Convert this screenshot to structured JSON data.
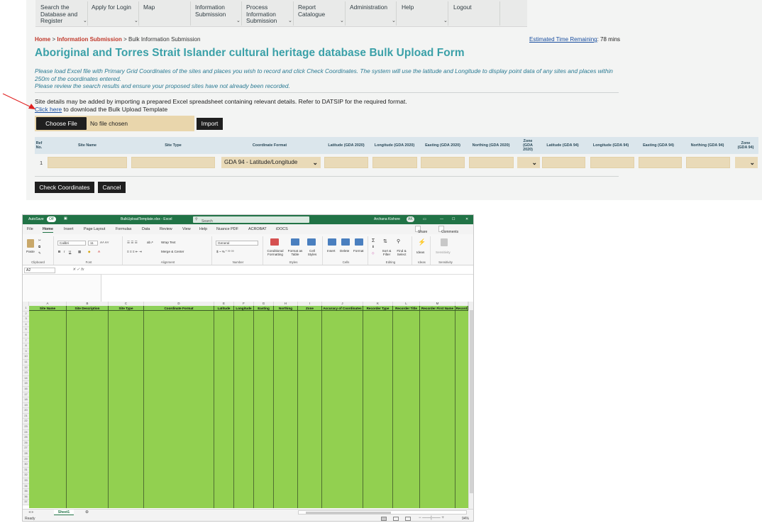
{
  "nav": {
    "items": [
      {
        "label": "Search the\nDatabase and\nRegister",
        "caret": true
      },
      {
        "label": "Apply for Login",
        "caret": true
      },
      {
        "label": "Map",
        "caret": false
      },
      {
        "label": "Information\nSubmission",
        "caret": true
      },
      {
        "label": "Process\nInformation\nSubmission",
        "caret": true
      },
      {
        "label": "Report\nCatalogue",
        "caret": true
      },
      {
        "label": "Administration",
        "caret": true
      },
      {
        "label": "Help",
        "caret": true
      },
      {
        "label": "Logout",
        "caret": false
      }
    ]
  },
  "breadcrumb": {
    "home": "Home",
    "sep1": " > ",
    "section": "Information Submission",
    "sep2": " > ",
    "current": "Bulk Information Submission"
  },
  "timer": {
    "label": "Estimated Time Remaining",
    "value": ": 78 mins"
  },
  "page": {
    "title": "Aboriginal and Torres Strait Islander cultural heritage database Bulk Upload Form",
    "intro1": "Please load Excel file with Primary Grid Coordinates of the sites and places you wish to record and click Check Coordinates. The system will use the latitude and Longitude to display point data of any sites and places within 250m of the coordinates entered.",
    "intro2": "Please review the search results and ensure your proposed sites have not already been recorded.",
    "note": "Site details may be added by importing a prepared Excel spreadsheet containing relevant details. Refer to DATSIP for the required format.",
    "click_here": "Click here",
    "download_text": " to download the Bulk Upload Template"
  },
  "upload": {
    "choose_label": "Choose File",
    "no_file": "No file chosen",
    "import_label": "Import"
  },
  "table": {
    "headers": [
      "Ref\nNo.",
      "Site Name",
      "Site Type",
      "Coordinate Format",
      "Latitude (GDA 2020)",
      "Longitude (GDA 2020)",
      "Easting (GDA 2020)",
      "Northing (GDA 2020)",
      "Zone\n(GDA\n2020)",
      "Latitude (GDA 94)",
      "Longitude (GDA 94)",
      "Easting (GDA 94)",
      "Northing (GDA 94)",
      "Zone\n(GDA 94)"
    ],
    "row_number": "1",
    "coord_format_value": "GDA 94 - Latitude/Longitude"
  },
  "actions": {
    "check_label": "Check Coordinates",
    "cancel_label": "Cancel"
  },
  "excel": {
    "title_autosave": "AutoSave",
    "autosave_state": "Off",
    "filename": "BulkUploadTemplate.xlsx  -  Excel",
    "search_placeholder": "Search",
    "user": "Archana Kishore",
    "user_initials": "AK",
    "tabs": [
      "File",
      "Home",
      "Insert",
      "Page Layout",
      "Formulas",
      "Data",
      "Review",
      "View",
      "Help",
      "Nuance PDF",
      "ACROBAT",
      "iDOCS"
    ],
    "active_tab": "Home",
    "share": "Share",
    "comments": "Comments",
    "ribbon_groups": [
      "Clipboard",
      "Font",
      "Alignment",
      "Number",
      "Styles",
      "Cells",
      "Editing",
      "Ideas",
      "Sensitivity"
    ],
    "font_name": "Calibri",
    "font_size": "11",
    "number_format": "General",
    "wrap_text": "Wrap Text",
    "merge_center": "Merge & Center",
    "paste": "Paste",
    "conditional": "Conditional Formatting",
    "format_table": "Format as Table",
    "cell_styles": "Cell Styles",
    "insert": "Insert",
    "delete": "Delete",
    "format": "Format",
    "sort_filter": "Sort & Filter",
    "find_select": "Find & Select",
    "ideas": "Ideas",
    "sensitivity": "Sensitivity",
    "name_box": "A2",
    "columns": [
      "A",
      "B",
      "C",
      "D",
      "E",
      "F",
      "G",
      "H",
      "I",
      "J",
      "K",
      "L",
      "M"
    ],
    "headers": [
      "Site Name",
      "Site Description",
      "Site Type",
      "Coordinate Format",
      "Latitude",
      "Longitude",
      "Easting",
      "Northing",
      "Zone",
      "Accuracy of Coordinates",
      "Recorder Type",
      "Recorder Title",
      "Recorder First Name",
      "Record"
    ],
    "sheet": "Sheet1",
    "status": "Ready",
    "zoom": "94%"
  }
}
